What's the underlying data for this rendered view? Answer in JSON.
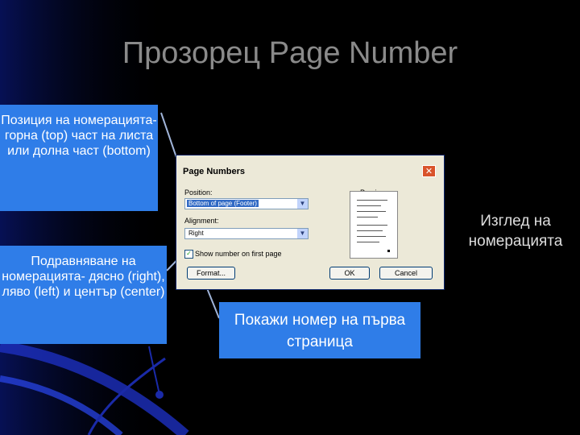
{
  "slide": {
    "title": "Прозорец Page Number",
    "callout_position": "Позиция на номерацията- горна (top) част на листа или долна част (bottom)",
    "callout_alignment": "Подравняване на номерацията- дясно (right), ляво (left) и център (center)",
    "callout_first_page": "Покажи номер на първа страница",
    "label_preview": "Изглед на номерацията"
  },
  "dialog": {
    "title": "Page Numbers",
    "close_glyph": "✕",
    "position_label": "Position:",
    "position_value": "Bottom of page (Footer)",
    "alignment_label": "Alignment:",
    "alignment_value": "Right",
    "show_first_page_label": "Show number on first page",
    "show_first_page_checked": "✓",
    "preview_label": "Preview",
    "format_button": "Format...",
    "ok_button": "OK",
    "cancel_button": "Cancel",
    "dropdown_glyph": "▼"
  },
  "colors": {
    "background": "#000000",
    "callout_blue": "#2f7de8",
    "title_gray": "#8a8a8a",
    "accent_dark_blue": "#0b1a6e"
  }
}
